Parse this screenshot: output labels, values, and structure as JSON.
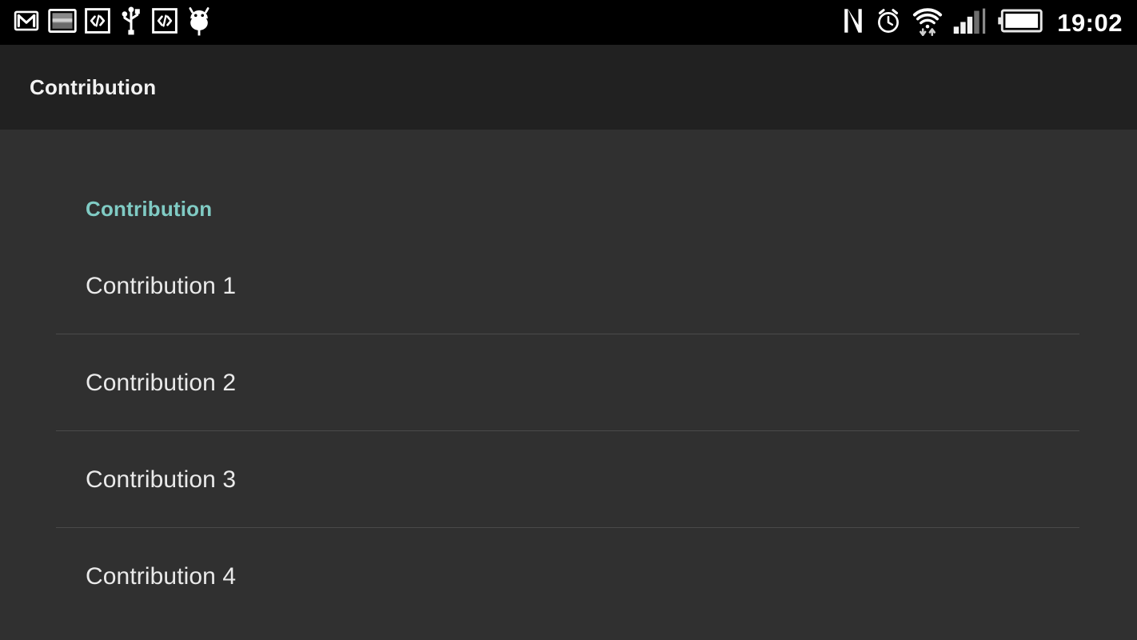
{
  "statusbar": {
    "left_icons": [
      {
        "name": "gmail-icon",
        "label": "Gmail"
      },
      {
        "name": "screenshot-icon",
        "label": "Screenshot"
      },
      {
        "name": "code-debug-icon",
        "label": "Developer"
      },
      {
        "name": "usb-icon",
        "label": "USB connected"
      },
      {
        "name": "code-debug-icon-2",
        "label": "Developer"
      },
      {
        "name": "android-debug-icon",
        "label": "USB debugging"
      }
    ],
    "right_icons": [
      {
        "name": "nfc-icon",
        "label": "NFC"
      },
      {
        "name": "alarm-icon",
        "label": "Alarm set"
      },
      {
        "name": "wifi-icon",
        "label": "Wi-Fi"
      },
      {
        "name": "signal-icon",
        "label": "Mobile signal"
      },
      {
        "name": "battery-icon",
        "label": "Battery full"
      }
    ],
    "clock": "19:02",
    "background": "#000000"
  },
  "actionbar": {
    "title": "Contribution",
    "background": "#212121",
    "title_color": "#f2f2f2"
  },
  "content": {
    "background": "#303030",
    "section_header": "Contribution",
    "section_header_color": "#80CBC4",
    "divider_color": "#4a4a4a",
    "item_text_color": "#eaeaea",
    "items": [
      {
        "label": "Contribution 1",
        "divider": true
      },
      {
        "label": "Contribution 2",
        "divider": true
      },
      {
        "label": "Contribution 3",
        "divider": true
      },
      {
        "label": "Contribution 4",
        "divider": false
      }
    ]
  }
}
